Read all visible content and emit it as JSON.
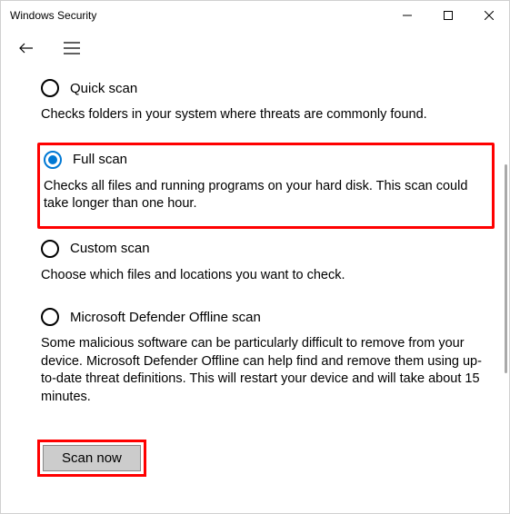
{
  "window": {
    "title": "Windows Security"
  },
  "options": [
    {
      "id": "quick",
      "title": "Quick scan",
      "desc": "Checks folders in your system where threats are commonly found.",
      "selected": false,
      "highlighted": false
    },
    {
      "id": "full",
      "title": "Full scan",
      "desc": "Checks all files and running programs on your hard disk. This scan could take longer than one hour.",
      "selected": true,
      "highlighted": true
    },
    {
      "id": "custom",
      "title": "Custom scan",
      "desc": "Choose which files and locations you want to check.",
      "selected": false,
      "highlighted": false
    },
    {
      "id": "offline",
      "title": "Microsoft Defender Offline scan",
      "desc": "Some malicious software can be particularly difficult to remove from your device. Microsoft Defender Offline can help find and remove them using up-to-date threat definitions. This will restart your device and will take about 15 minutes.",
      "selected": false,
      "highlighted": false
    }
  ],
  "actions": {
    "scan_now": "Scan now"
  }
}
